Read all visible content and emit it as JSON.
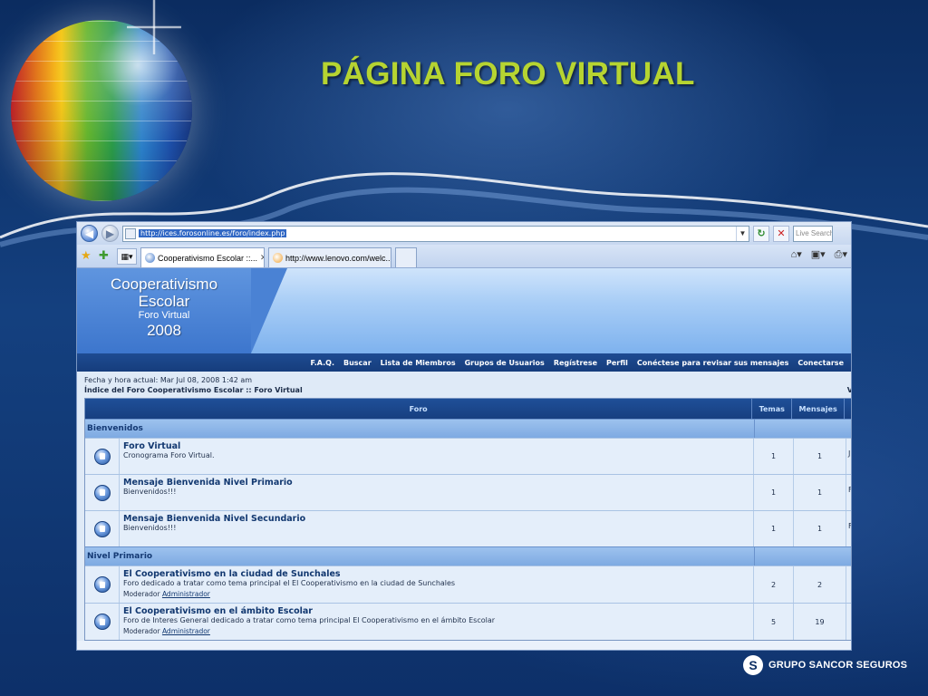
{
  "slide": {
    "title": "PÁGINA FORO VIRTUAL",
    "brand": "GRUPO SANCOR SEGUROS",
    "brand_symbol": "S"
  },
  "browser": {
    "address_url": "http://ices.forosonline.es/foro/index.php",
    "search_placeholder": "Live Search",
    "tabs": [
      {
        "label": "Cooperativismo Escolar ::...",
        "active": true
      },
      {
        "label": "http://www.lenovo.com/welc...",
        "active": false
      }
    ],
    "icons": {
      "back": "back-arrow-icon",
      "forward": "forward-arrow-icon",
      "refresh": "refresh-icon",
      "stop": "stop-icon",
      "favorites": "star-icon",
      "add_favorite": "add-favorite-icon",
      "home": "home-icon",
      "feeds": "rss-icon",
      "print": "print-icon"
    }
  },
  "forum": {
    "logo": {
      "line1": "Cooperativismo",
      "line2": "Escolar",
      "line3": "Foro Virtual",
      "line4": "2008"
    },
    "nav": [
      "F.A.Q.",
      "Buscar",
      "Lista de Miembros",
      "Grupos de Usuarios",
      "Regístrese",
      "Perfil",
      "Conéctese para revisar sus mensajes",
      "Conectarse"
    ],
    "datetime": "Fecha y hora actual: Mar Jul 08, 2008 1:42 am",
    "breadcrumb": "Índice del Foro Cooperativismo Escolar :: Foro Virtual",
    "breadcrumb_extra": "V",
    "columns": {
      "forum": "Foro",
      "topics": "Temas",
      "messages": "Mensajes"
    },
    "categories": [
      {
        "name": "Bienvenidos",
        "forums": [
          {
            "title": "Foro Virtual",
            "desc": "Cronograma Foro Virtual.",
            "topics": "1",
            "messages": "1",
            "last": "J"
          },
          {
            "title": "Mensaje Bienvenida Nivel Primario",
            "desc": "Bienvenidos!!!",
            "topics": "1",
            "messages": "1",
            "last": "F"
          },
          {
            "title": "Mensaje Bienvenida Nivel Secundario",
            "desc": "Bienvenidos!!!",
            "topics": "1",
            "messages": "1",
            "last": "F"
          }
        ]
      },
      {
        "name": "Nivel Primario",
        "forums": [
          {
            "title": "El Cooperativismo en la ciudad de Sunchales",
            "desc": "Foro dedicado a tratar como tema principal el El Cooperativismo en la ciudad de Sunchales",
            "mod_label": "Moderador",
            "mod_name": "Administrador",
            "topics": "2",
            "messages": "2",
            "last": ""
          },
          {
            "title": "El Cooperativismo en el ámbito Escolar",
            "desc": "Foro de Interes General dedicado a tratar como tema principal El Cooperativismo en el ámbito Escolar",
            "mod_label": "Moderador",
            "mod_name": "Administrador",
            "topics": "5",
            "messages": "19",
            "last": ""
          }
        ]
      }
    ]
  }
}
